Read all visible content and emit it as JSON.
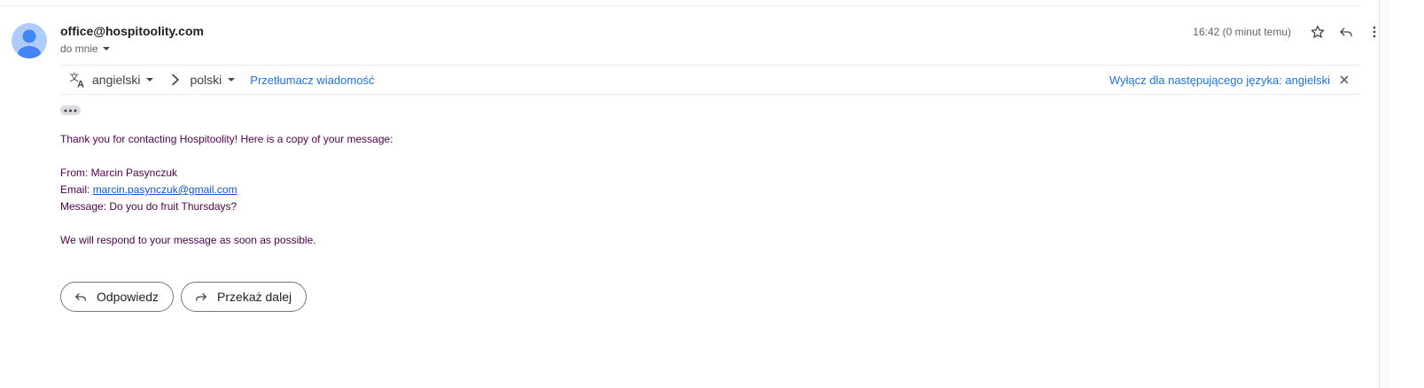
{
  "header": {
    "sender": "office@hospitoolity.com",
    "recipient_label": "do mnie",
    "time": "16:42 (0 minut temu)"
  },
  "translation": {
    "from_language": "angielski",
    "to_language": "polski",
    "translate_link": "Przetłumacz wiadomość",
    "disable_text": "Wyłącz dla następującego języka: angielski"
  },
  "message": {
    "intro": "Thank you for contacting Hospitoolity! Here is a copy of your message:",
    "from_line": "From: Marcin Pasynczuk",
    "email_prefix": "Email: ",
    "email_link": "marcin.pasynczuk@gmail.com",
    "message_line": "Message: Do you do fruit Thursdays?",
    "closing": "We will respond to your message as soon as possible."
  },
  "actions": {
    "reply_label": "Odpowiedz",
    "forward_label": "Przekaż dalej"
  },
  "colors": {
    "body_text": "#500050",
    "link": "#1155cc",
    "accent": "#1a73e8",
    "avatar_bg": "#aecbfa",
    "avatar_fg": "#4285f4"
  }
}
